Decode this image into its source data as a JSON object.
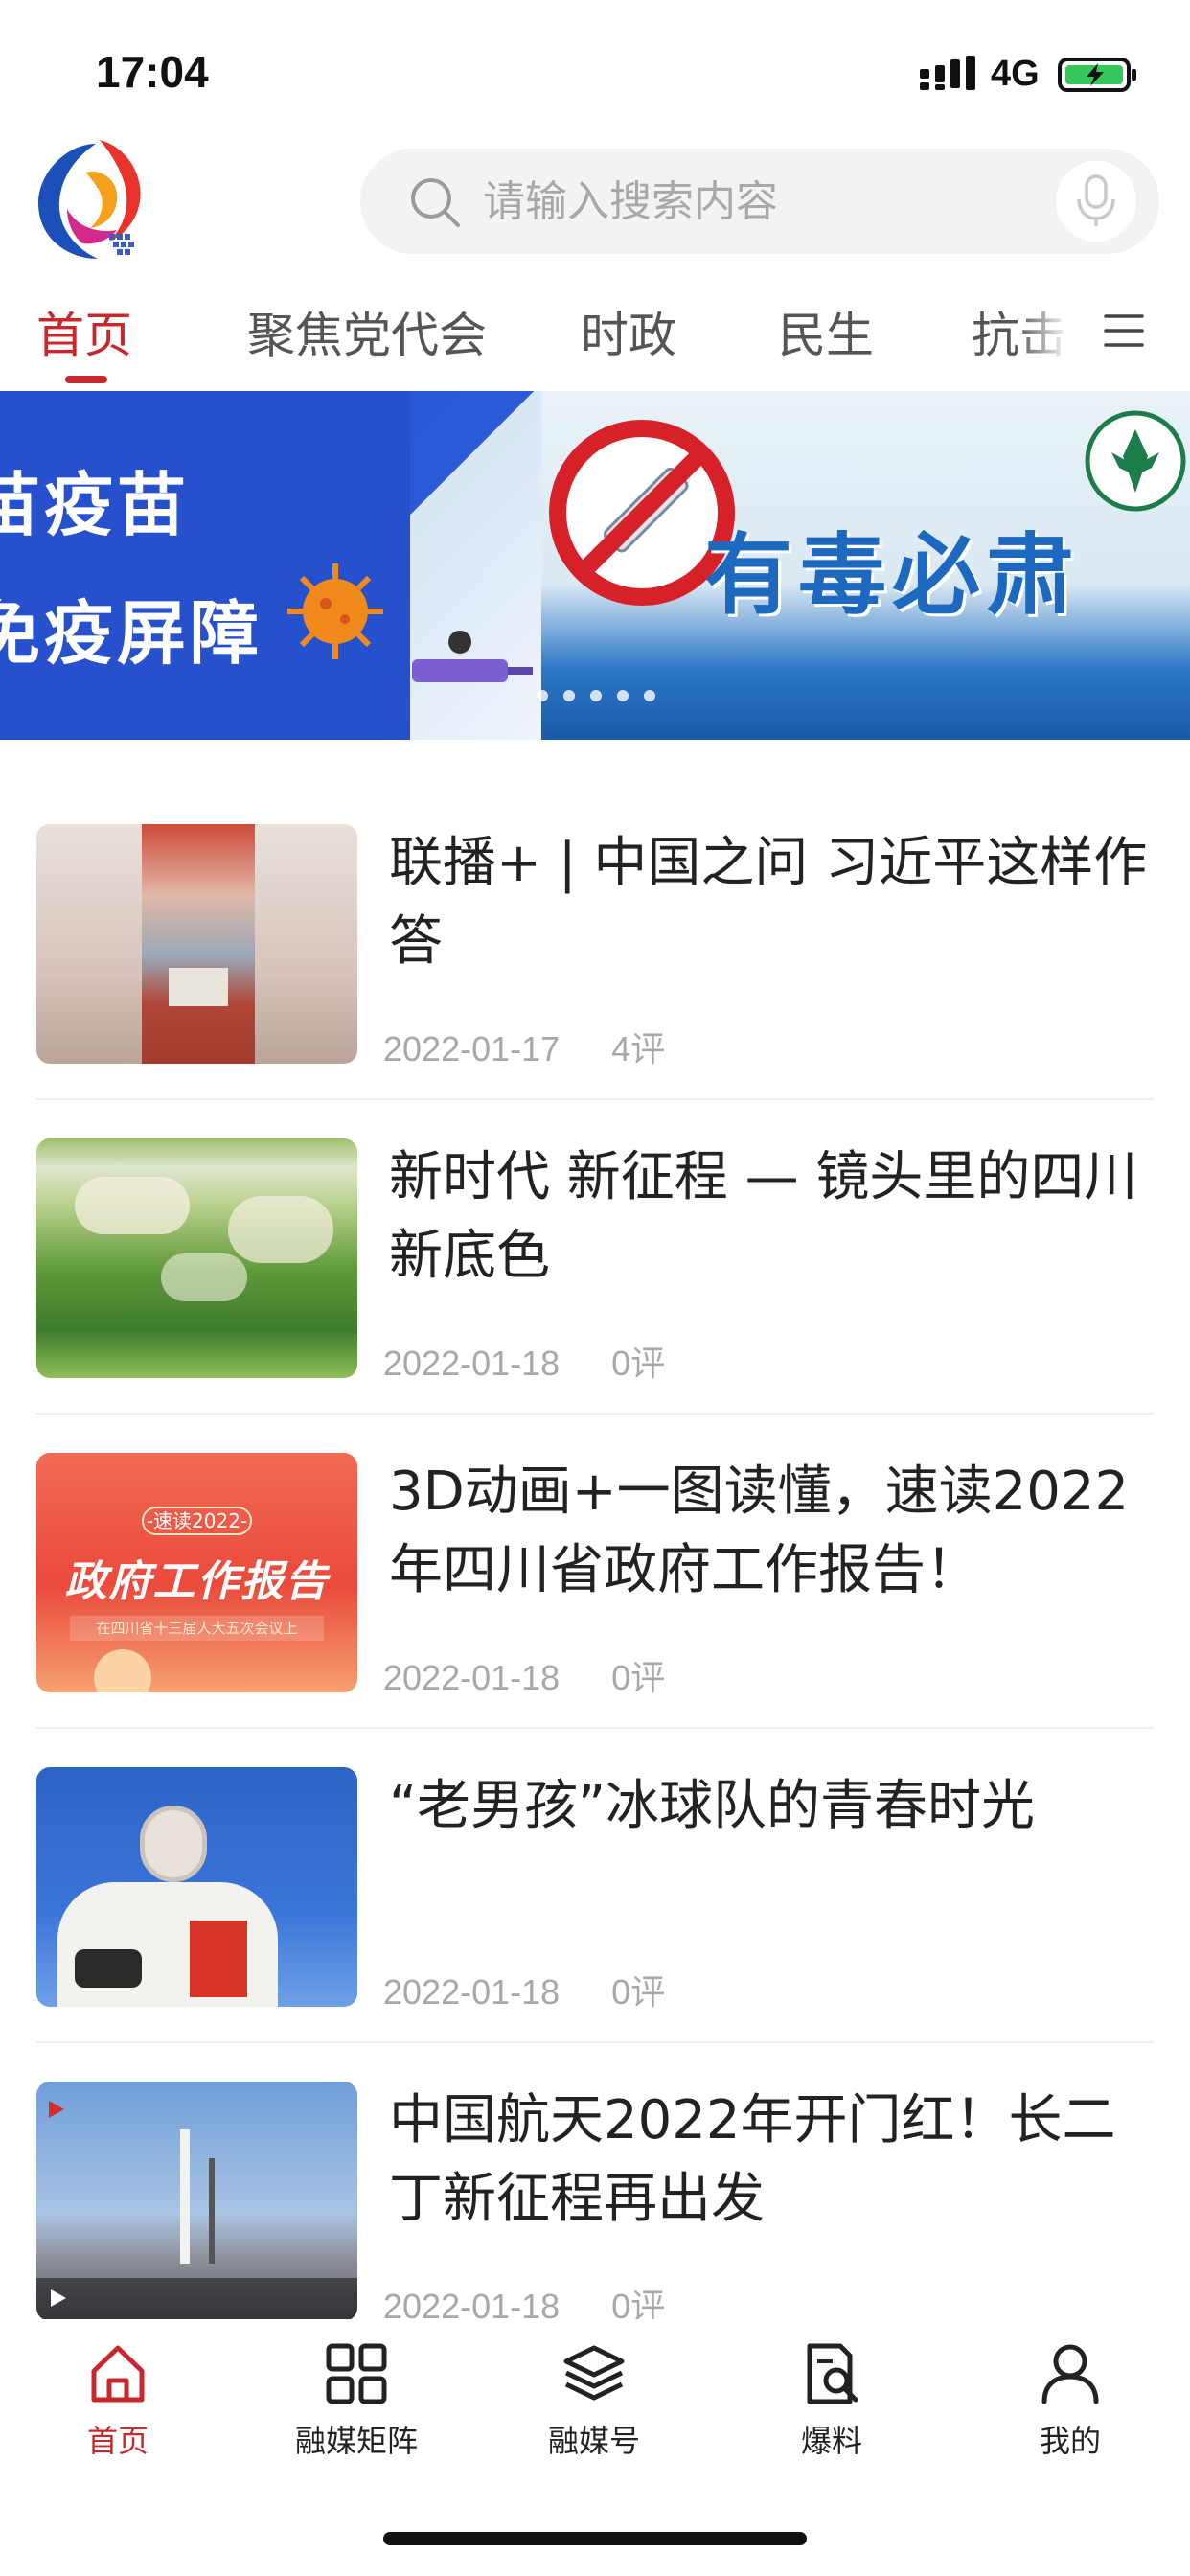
{
  "status_bar": {
    "time": "17:04",
    "network": "4G",
    "icons": [
      "signal-icon",
      "battery-charging-icon"
    ]
  },
  "header": {
    "logo": "app-logo",
    "search": {
      "placeholder": "请输入搜索内容",
      "icon": "search-icon",
      "voice_icon": "microphone-icon"
    }
  },
  "tabs": {
    "items": [
      {
        "label": "首页",
        "active": true
      },
      {
        "label": "聚焦党代会"
      },
      {
        "label": "时政"
      },
      {
        "label": "民生"
      },
      {
        "label": "抗击"
      }
    ],
    "menu_icon": "menu-icon"
  },
  "banner": {
    "slides": [
      {
        "line1": "苗疫苗",
        "line2": "免疫屏障"
      },
      {
        "text": "有毒必肃"
      }
    ],
    "dots_count": 5
  },
  "news": [
    {
      "title": "联播+ | 中国之问 习近平这样作答",
      "date": "2022-01-17",
      "comments": "4评"
    },
    {
      "title": "新时代 新征程 — 镜头里的四川新底色",
      "date": "2022-01-18",
      "comments": "0评"
    },
    {
      "title": "3D动画+一图读懂，速读2022年四川省政府工作报告！",
      "date": "2022-01-18",
      "comments": "0评",
      "thumb_title": "政府工作报告",
      "thumb_tag": "-速读2022-",
      "thumb_sub": "在四川省十三届人大五次会议上"
    },
    {
      "title": "“老男孩”冰球队的青春时光",
      "date": "2022-01-18",
      "comments": "0评"
    },
    {
      "title": "中国航天2022年开门红！长二丁新征程再出发",
      "date": "2022-01-18",
      "comments": "0评"
    }
  ],
  "bottom_nav": [
    {
      "label": "首页",
      "icon": "home-icon",
      "active": true
    },
    {
      "label": "融媒矩阵",
      "icon": "grid-icon"
    },
    {
      "label": "融媒号",
      "icon": "layers-icon"
    },
    {
      "label": "爆料",
      "icon": "report-search-icon"
    },
    {
      "label": "我的",
      "icon": "user-icon"
    }
  ],
  "colors": {
    "accent": "#c8282c",
    "text": "#222222",
    "meta": "#a8a8a8"
  }
}
